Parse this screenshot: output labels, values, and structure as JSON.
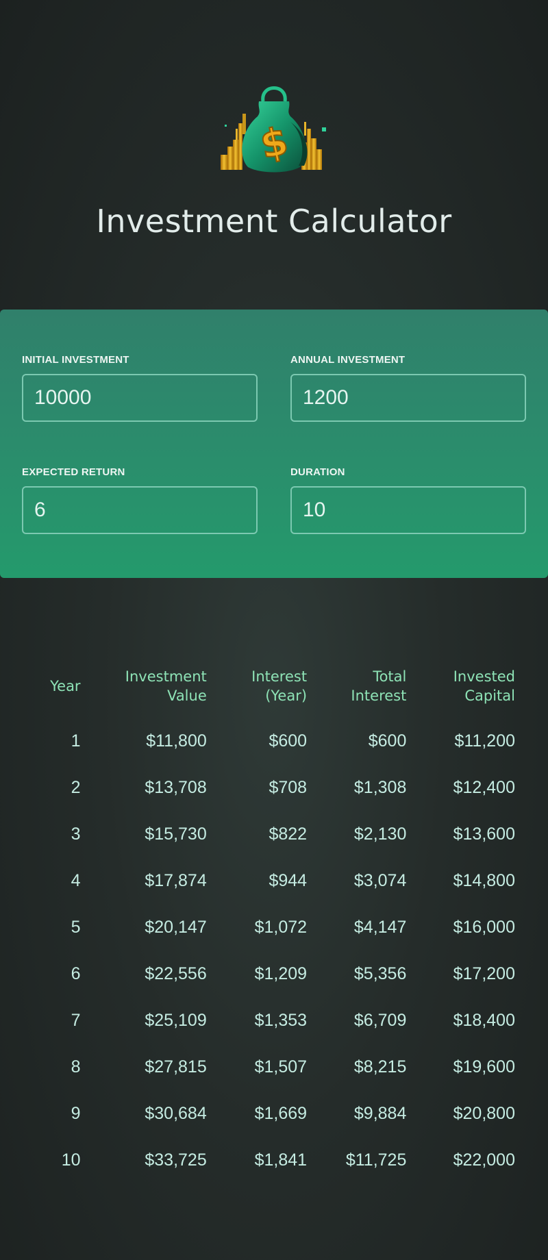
{
  "header": {
    "title": "Investment Calculator",
    "logo_icon": "money-bag-with-coins-icon",
    "colors": {
      "bag": "#1fa877",
      "coins": "#e0a418",
      "dollar": "#f0a81a"
    }
  },
  "inputs": {
    "initial_investment": {
      "label": "INITIAL INVESTMENT",
      "value": "10000"
    },
    "annual_investment": {
      "label": "ANNUAL INVESTMENT",
      "value": "1200"
    },
    "expected_return": {
      "label": "EXPECTED RETURN",
      "value": "6"
    },
    "duration": {
      "label": "DURATION",
      "value": "10"
    }
  },
  "results": {
    "headers": [
      [
        "Year",
        ""
      ],
      [
        "Investment",
        "Value"
      ],
      [
        "Interest",
        "(Year)"
      ],
      [
        "Total",
        "Interest"
      ],
      [
        "Invested",
        "Capital"
      ]
    ],
    "rows": [
      [
        "1",
        "$11,800",
        "$600",
        "$600",
        "$11,200"
      ],
      [
        "2",
        "$13,708",
        "$708",
        "$1,308",
        "$12,400"
      ],
      [
        "3",
        "$15,730",
        "$822",
        "$2,130",
        "$13,600"
      ],
      [
        "4",
        "$17,874",
        "$944",
        "$3,074",
        "$14,800"
      ],
      [
        "5",
        "$20,147",
        "$1,072",
        "$4,147",
        "$16,000"
      ],
      [
        "6",
        "$22,556",
        "$1,209",
        "$5,356",
        "$17,200"
      ],
      [
        "7",
        "$25,109",
        "$1,353",
        "$6,709",
        "$18,400"
      ],
      [
        "8",
        "$27,815",
        "$1,507",
        "$8,215",
        "$19,600"
      ],
      [
        "9",
        "$30,684",
        "$1,669",
        "$9,884",
        "$20,800"
      ],
      [
        "10",
        "$33,725",
        "$1,841",
        "$11,725",
        "$22,000"
      ]
    ]
  },
  "colors": {
    "accent_header_text": "#8ee3b6",
    "panel_top": "#30806b",
    "panel_bottom": "#249a6c",
    "cell_text": "#c5ece2"
  }
}
